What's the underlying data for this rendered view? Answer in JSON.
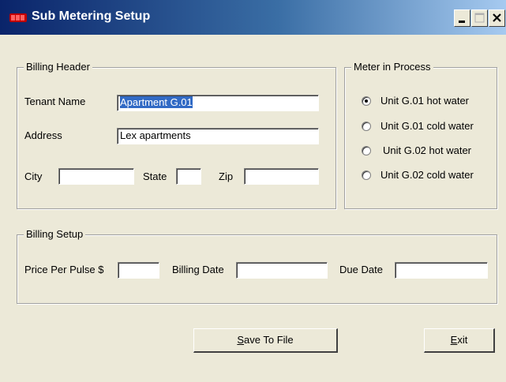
{
  "window": {
    "title": "Sub Metering Setup",
    "app_icon": "battery-icon",
    "controls": {
      "minimize": "minimize-icon",
      "maximize": "maximize-icon",
      "close": "close-icon"
    }
  },
  "billing_header": {
    "legend": "Billing Header",
    "tenant_name_label": "Tenant Name",
    "tenant_name_value": "Apartment G.01",
    "address_label": "Address",
    "address_value": "Lex apartments",
    "city_label": "City",
    "city_value": "",
    "state_label": "State",
    "state_value": "",
    "zip_label": "Zip",
    "zip_value": ""
  },
  "meter_in_process": {
    "legend": "Meter in Process",
    "options": [
      {
        "label": "Unit G.01 hot water",
        "checked": true
      },
      {
        "label": "Unit G.01 cold water",
        "checked": false
      },
      {
        "label": "Unit G.02 hot water",
        "checked": false
      },
      {
        "label": "Unit G.02 cold water",
        "checked": false
      }
    ]
  },
  "billing_setup": {
    "legend": "Billing Setup",
    "price_label": "Price Per Pulse $",
    "price_value": "",
    "billing_date_label": "Billing Date",
    "billing_date_value": "",
    "due_date_label": "Due Date",
    "due_date_value": ""
  },
  "buttons": {
    "save": {
      "accel": "S",
      "rest": "ave To File"
    },
    "exit": {
      "accel": "E",
      "rest": "xit"
    }
  },
  "colors": {
    "titlebar_start": "#0a246a",
    "titlebar_end": "#a6caf0",
    "face": "#ece9d8",
    "selection": "#316ac5"
  }
}
